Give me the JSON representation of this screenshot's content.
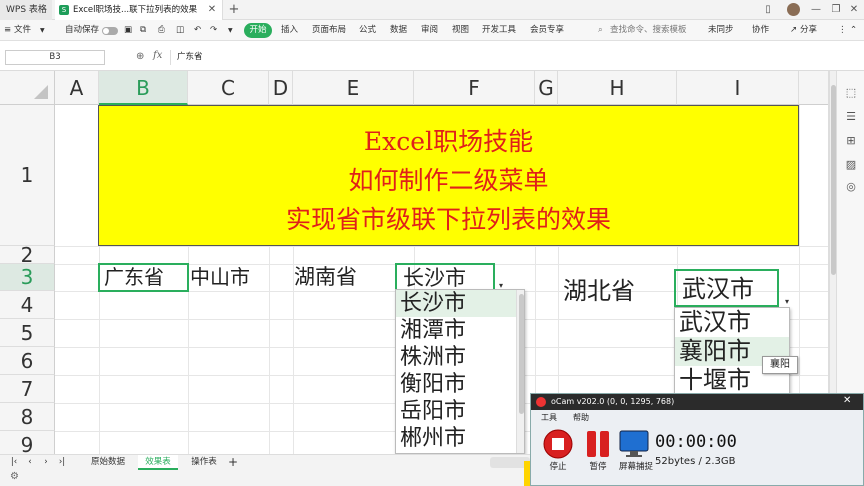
{
  "titlebar": {
    "app_name": "WPS 表格",
    "doc_tab": "Excel职场技...联下拉列表的效果",
    "doc_icon": "S",
    "add_tab": "+"
  },
  "menubar": {
    "items": [
      "文件",
      "自动保存",
      "开始",
      "插入",
      "页面布局",
      "公式",
      "数据",
      "审阅",
      "视图",
      "开发工具",
      "会员专享"
    ],
    "search_placeholder": "查找命令、搜索模板",
    "right_items": [
      "未同步",
      "协作",
      "分享"
    ]
  },
  "formula_bar": {
    "name_box": "B3",
    "fx": "fx",
    "content": "广东省"
  },
  "grid": {
    "columns": [
      "A",
      "B",
      "C",
      "D",
      "E",
      "F",
      "G",
      "H",
      "I"
    ],
    "rows": [
      "1",
      "2",
      "3",
      "4",
      "5",
      "6",
      "7",
      "8",
      "9"
    ],
    "selected_column": "B",
    "selected_row": "3",
    "banner_lines": [
      "Excel职场技能",
      "如何制作二级菜单",
      "实现省市级联下拉列表的效果"
    ],
    "cells": {
      "B3": "广东省",
      "C3": "中山市",
      "E3": "湖南省",
      "F3": "长沙市",
      "H3": "湖北省",
      "I3": "武汉市"
    }
  },
  "dropdown_hunan": {
    "items": [
      "长沙市",
      "湘潭市",
      "株洲市",
      "衡阳市",
      "岳阳市",
      "郴州市"
    ],
    "highlighted": 0
  },
  "dropdown_hubei": {
    "items": [
      "武汉市",
      "襄阳市",
      "十堰市"
    ],
    "highlighted": 1,
    "tooltip": "襄阳"
  },
  "sheet_tabs": {
    "tabs": [
      "原始数据",
      "效果表",
      "操作表"
    ],
    "active": 1,
    "add": "+"
  },
  "ocam": {
    "title": "oCam v202.0 (0, 0, 1295, 768)",
    "menu": [
      "工具",
      "帮助"
    ],
    "buttons": [
      "停止",
      "暂停",
      "屏幕捕捉"
    ],
    "timer": "00:00:00",
    "size": "52bytes / 2.3GB"
  }
}
